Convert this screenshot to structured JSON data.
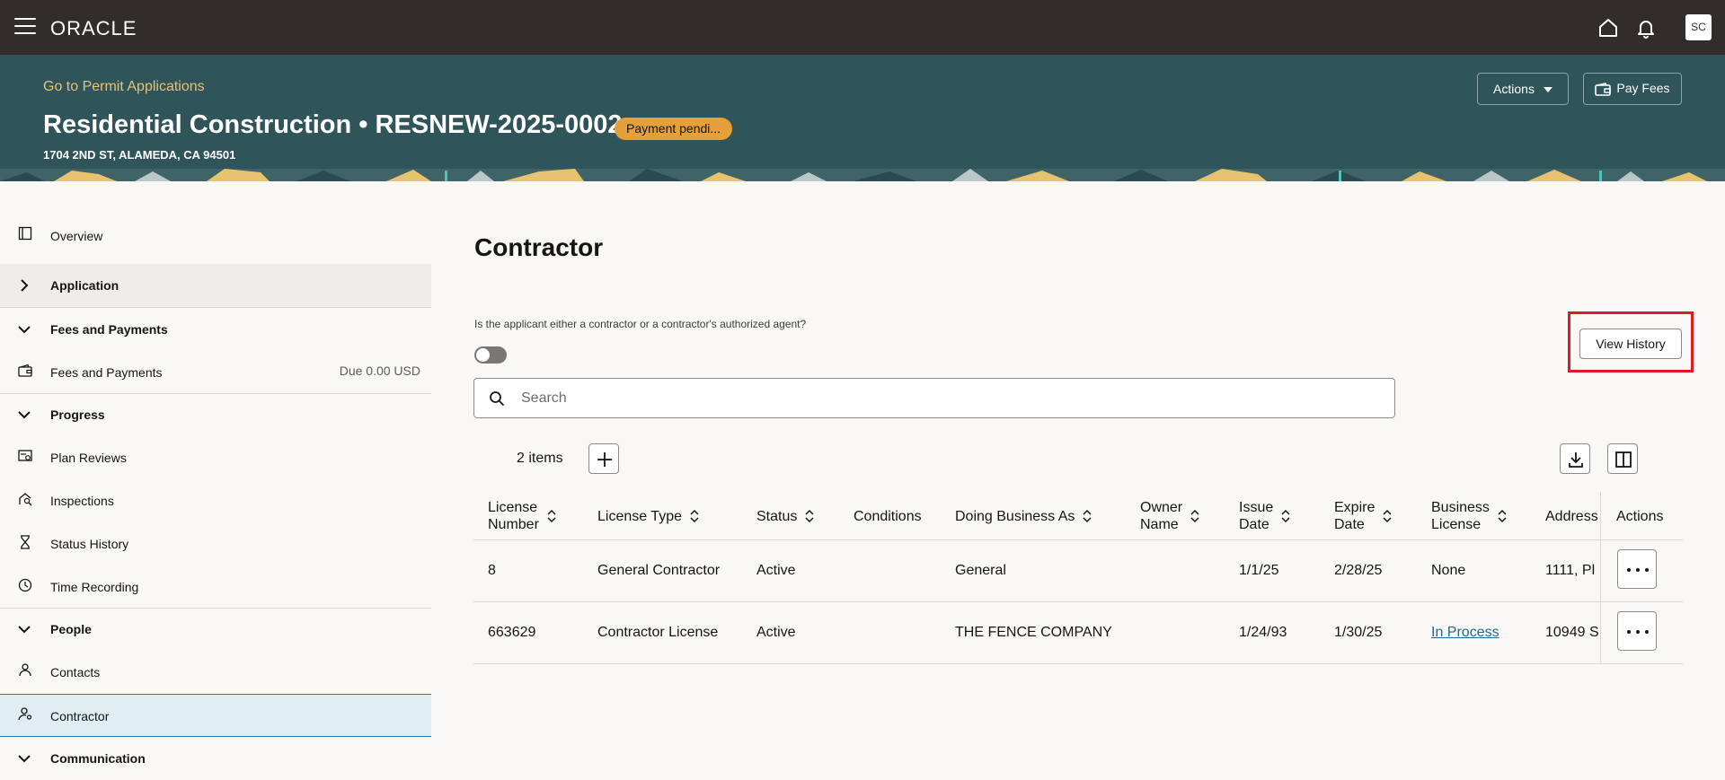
{
  "topbar": {
    "logo": "ORACLE",
    "avatar_initials": "SC",
    "icons": [
      "menu-icon",
      "home-icon",
      "bell-icon"
    ]
  },
  "header": {
    "back_link": "Go to Permit Applications",
    "title": "Residential Construction • RESNEW-2025-0002",
    "status": "Payment pendi...",
    "address": "1704 2ND ST, ALAMEDA, CA 94501",
    "actions_label": "Actions",
    "pay_fees_label": "Pay Fees"
  },
  "sidebar": {
    "overview": "Overview",
    "application": "Application",
    "fees_group": "Fees and Payments",
    "fees_item": "Fees and Payments",
    "fees_due": "Due 0.00 USD",
    "progress": "Progress",
    "plan_reviews": "Plan Reviews",
    "inspections": "Inspections",
    "status_history": "Status History",
    "time_recording": "Time Recording",
    "people": "People",
    "contacts": "Contacts",
    "contractor": "Contractor",
    "communication": "Communication"
  },
  "main": {
    "title": "Contractor",
    "question": "Is the applicant either a contractor or a contractor's authorized agent?",
    "toggle_on": false,
    "view_history": "View History",
    "search_placeholder": "Search",
    "items_count": "2 items"
  },
  "table": {
    "headers": {
      "license_number": [
        "License",
        "Number"
      ],
      "license_type": "License Type",
      "status": "Status",
      "conditions": "Conditions",
      "doing_business_as": "Doing Business As",
      "owner_name": [
        "Owner",
        "Name"
      ],
      "issue_date": [
        "Issue",
        "Date"
      ],
      "expire_date": [
        "Expire",
        "Date"
      ],
      "business_license": [
        "Business",
        "License"
      ],
      "address": "Address",
      "actions": "Actions"
    },
    "rows": [
      {
        "license_number": "8",
        "license_type": "General Contractor",
        "status": "Active",
        "conditions": "",
        "doing_business_as": "General",
        "owner_name": "",
        "issue_date": "1/1/25",
        "expire_date": "2/28/25",
        "business_license": "None",
        "address": "1111, Pl"
      },
      {
        "license_number": "663629",
        "license_type": "Contractor License",
        "status": "Active",
        "conditions": "",
        "doing_business_as": "THE FENCE COMPANY",
        "owner_name": "",
        "issue_date": "1/24/93",
        "expire_date": "1/30/25",
        "business_license": "In Process",
        "address": "10949 S"
      }
    ]
  },
  "colors": {
    "topbar": "#312d2a",
    "header": "#2f5459",
    "link_gold": "#e8c275",
    "status_pill": "#e5a03a",
    "highlight_red": "#e01a22",
    "link_blue": "#1d6a8f"
  }
}
